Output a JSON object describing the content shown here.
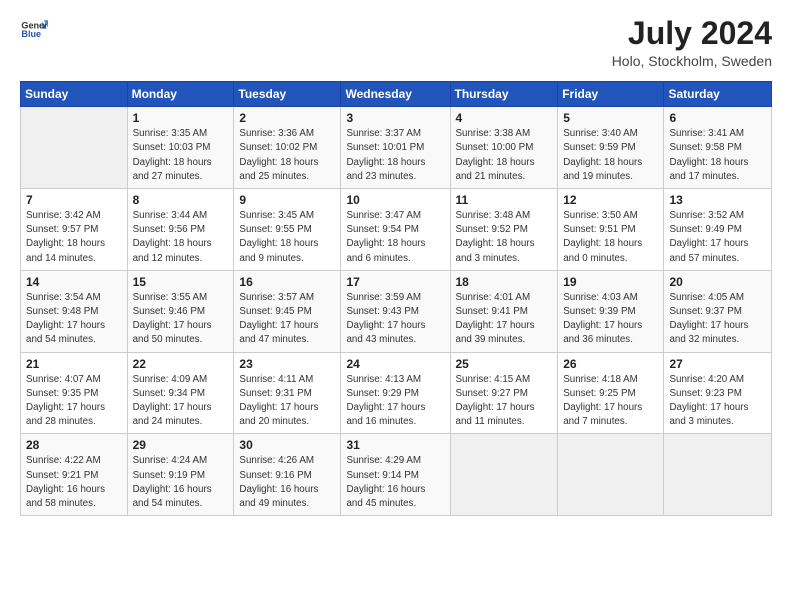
{
  "header": {
    "logo_general": "General",
    "logo_blue": "Blue",
    "month_year": "July 2024",
    "location": "Holo, Stockholm, Sweden"
  },
  "weekdays": [
    "Sunday",
    "Monday",
    "Tuesday",
    "Wednesday",
    "Thursday",
    "Friday",
    "Saturday"
  ],
  "weeks": [
    [
      {
        "day": "",
        "info": ""
      },
      {
        "day": "1",
        "info": "Sunrise: 3:35 AM\nSunset: 10:03 PM\nDaylight: 18 hours\nand 27 minutes."
      },
      {
        "day": "2",
        "info": "Sunrise: 3:36 AM\nSunset: 10:02 PM\nDaylight: 18 hours\nand 25 minutes."
      },
      {
        "day": "3",
        "info": "Sunrise: 3:37 AM\nSunset: 10:01 PM\nDaylight: 18 hours\nand 23 minutes."
      },
      {
        "day": "4",
        "info": "Sunrise: 3:38 AM\nSunset: 10:00 PM\nDaylight: 18 hours\nand 21 minutes."
      },
      {
        "day": "5",
        "info": "Sunrise: 3:40 AM\nSunset: 9:59 PM\nDaylight: 18 hours\nand 19 minutes."
      },
      {
        "day": "6",
        "info": "Sunrise: 3:41 AM\nSunset: 9:58 PM\nDaylight: 18 hours\nand 17 minutes."
      }
    ],
    [
      {
        "day": "7",
        "info": "Sunrise: 3:42 AM\nSunset: 9:57 PM\nDaylight: 18 hours\nand 14 minutes."
      },
      {
        "day": "8",
        "info": "Sunrise: 3:44 AM\nSunset: 9:56 PM\nDaylight: 18 hours\nand 12 minutes."
      },
      {
        "day": "9",
        "info": "Sunrise: 3:45 AM\nSunset: 9:55 PM\nDaylight: 18 hours\nand 9 minutes."
      },
      {
        "day": "10",
        "info": "Sunrise: 3:47 AM\nSunset: 9:54 PM\nDaylight: 18 hours\nand 6 minutes."
      },
      {
        "day": "11",
        "info": "Sunrise: 3:48 AM\nSunset: 9:52 PM\nDaylight: 18 hours\nand 3 minutes."
      },
      {
        "day": "12",
        "info": "Sunrise: 3:50 AM\nSunset: 9:51 PM\nDaylight: 18 hours\nand 0 minutes."
      },
      {
        "day": "13",
        "info": "Sunrise: 3:52 AM\nSunset: 9:49 PM\nDaylight: 17 hours\nand 57 minutes."
      }
    ],
    [
      {
        "day": "14",
        "info": "Sunrise: 3:54 AM\nSunset: 9:48 PM\nDaylight: 17 hours\nand 54 minutes."
      },
      {
        "day": "15",
        "info": "Sunrise: 3:55 AM\nSunset: 9:46 PM\nDaylight: 17 hours\nand 50 minutes."
      },
      {
        "day": "16",
        "info": "Sunrise: 3:57 AM\nSunset: 9:45 PM\nDaylight: 17 hours\nand 47 minutes."
      },
      {
        "day": "17",
        "info": "Sunrise: 3:59 AM\nSunset: 9:43 PM\nDaylight: 17 hours\nand 43 minutes."
      },
      {
        "day": "18",
        "info": "Sunrise: 4:01 AM\nSunset: 9:41 PM\nDaylight: 17 hours\nand 39 minutes."
      },
      {
        "day": "19",
        "info": "Sunrise: 4:03 AM\nSunset: 9:39 PM\nDaylight: 17 hours\nand 36 minutes."
      },
      {
        "day": "20",
        "info": "Sunrise: 4:05 AM\nSunset: 9:37 PM\nDaylight: 17 hours\nand 32 minutes."
      }
    ],
    [
      {
        "day": "21",
        "info": "Sunrise: 4:07 AM\nSunset: 9:35 PM\nDaylight: 17 hours\nand 28 minutes."
      },
      {
        "day": "22",
        "info": "Sunrise: 4:09 AM\nSunset: 9:34 PM\nDaylight: 17 hours\nand 24 minutes."
      },
      {
        "day": "23",
        "info": "Sunrise: 4:11 AM\nSunset: 9:31 PM\nDaylight: 17 hours\nand 20 minutes."
      },
      {
        "day": "24",
        "info": "Sunrise: 4:13 AM\nSunset: 9:29 PM\nDaylight: 17 hours\nand 16 minutes."
      },
      {
        "day": "25",
        "info": "Sunrise: 4:15 AM\nSunset: 9:27 PM\nDaylight: 17 hours\nand 11 minutes."
      },
      {
        "day": "26",
        "info": "Sunrise: 4:18 AM\nSunset: 9:25 PM\nDaylight: 17 hours\nand 7 minutes."
      },
      {
        "day": "27",
        "info": "Sunrise: 4:20 AM\nSunset: 9:23 PM\nDaylight: 17 hours\nand 3 minutes."
      }
    ],
    [
      {
        "day": "28",
        "info": "Sunrise: 4:22 AM\nSunset: 9:21 PM\nDaylight: 16 hours\nand 58 minutes."
      },
      {
        "day": "29",
        "info": "Sunrise: 4:24 AM\nSunset: 9:19 PM\nDaylight: 16 hours\nand 54 minutes."
      },
      {
        "day": "30",
        "info": "Sunrise: 4:26 AM\nSunset: 9:16 PM\nDaylight: 16 hours\nand 49 minutes."
      },
      {
        "day": "31",
        "info": "Sunrise: 4:29 AM\nSunset: 9:14 PM\nDaylight: 16 hours\nand 45 minutes."
      },
      {
        "day": "",
        "info": ""
      },
      {
        "day": "",
        "info": ""
      },
      {
        "day": "",
        "info": ""
      }
    ]
  ]
}
